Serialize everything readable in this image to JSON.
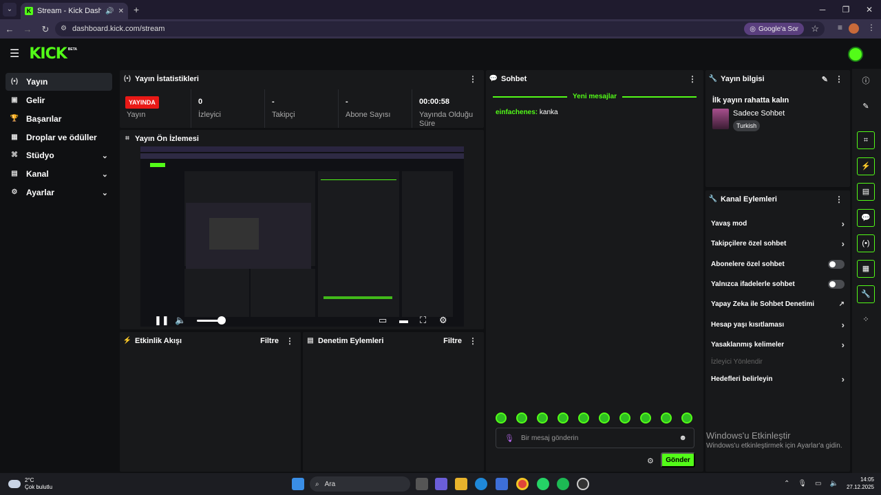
{
  "browser": {
    "tab_title": "Stream - Kick Dashboard",
    "url": "dashboard.kick.com/stream",
    "google_btn": "Google'a Sor"
  },
  "header": {
    "logo": "KICK",
    "beta": "BETA"
  },
  "sidebar": {
    "items": [
      {
        "label": "Yayın",
        "icon": "broadcast-icon"
      },
      {
        "label": "Gelir",
        "icon": "revenue-icon"
      },
      {
        "label": "Başarılar",
        "icon": "trophy-icon"
      },
      {
        "label": "Droplar ve ödüller",
        "icon": "drops-icon"
      },
      {
        "label": "Stüdyo",
        "icon": "studio-icon"
      },
      {
        "label": "Kanal",
        "icon": "channel-icon"
      },
      {
        "label": "Ayarlar",
        "icon": "settings-icon"
      }
    ]
  },
  "stats": {
    "title": "Yayın İstatistikleri",
    "live_badge": "YAYINDA",
    "items": [
      {
        "value": "",
        "label": "Yayın"
      },
      {
        "value": "0",
        "label": "İzleyici"
      },
      {
        "value": "-",
        "label": "Takipçi"
      },
      {
        "value": "-",
        "label": "Abone Sayısı"
      },
      {
        "value": "00:00:58",
        "label": "Yayında Olduğu Süre"
      }
    ]
  },
  "preview": {
    "title": "Yayın Ön İzlemesi",
    "volume_fraction": 0.9
  },
  "activity": {
    "title": "Etkinlik Akışı",
    "filter": "Filtre"
  },
  "moderation": {
    "title": "Denetim Eylemleri",
    "filter": "Filtre"
  },
  "chat": {
    "title": "Sohbet",
    "new_messages": "Yeni mesajlar",
    "message": {
      "user": "einfachenes:",
      "text": "kanka"
    },
    "placeholder": "Bir mesaj gönderin",
    "send": "Gönder"
  },
  "stream_info": {
    "title": "Yayın bilgisi",
    "stream_title": "İlk yayın rahatta kalın",
    "category": "Sadece Sohbet",
    "language": "Turkish"
  },
  "channel_actions": {
    "title": "Kanal Eylemleri",
    "items": [
      {
        "label": "Yavaş mod",
        "control": "chevron"
      },
      {
        "label": "Takipçilere özel sohbet",
        "control": "chevron"
      },
      {
        "label": "Abonelere özel sohbet",
        "control": "toggle",
        "on": false
      },
      {
        "label": "Yalnızca ifadelerle sohbet",
        "control": "toggle",
        "on": false
      },
      {
        "label": "Yapay Zeka ile Sohbet Denetimi",
        "control": "external"
      },
      {
        "label": "Hesap yaşı kısıtlaması",
        "control": "chevron"
      },
      {
        "label": "Yasaklanmış kelimeler",
        "control": "chevron"
      },
      {
        "label": "İzleyici Yönlendir",
        "control": "none",
        "disabled": true
      },
      {
        "label": "Hedefleri belirleyin",
        "control": "chevron"
      }
    ]
  },
  "watermark": {
    "line1": "Windows'u Etkinleştir",
    "line2": "Windows'u etkinleştirmek için Ayarlar'a gidin."
  },
  "taskbar": {
    "temp": "2°C",
    "weather": "Çok bulutlu",
    "search": "Ara",
    "time": "14:05",
    "date": "27.12.2025"
  },
  "colors": {
    "accent": "#53fc18",
    "live": "#e91916",
    "panel": "#18191b",
    "bg": "#0f1012"
  }
}
